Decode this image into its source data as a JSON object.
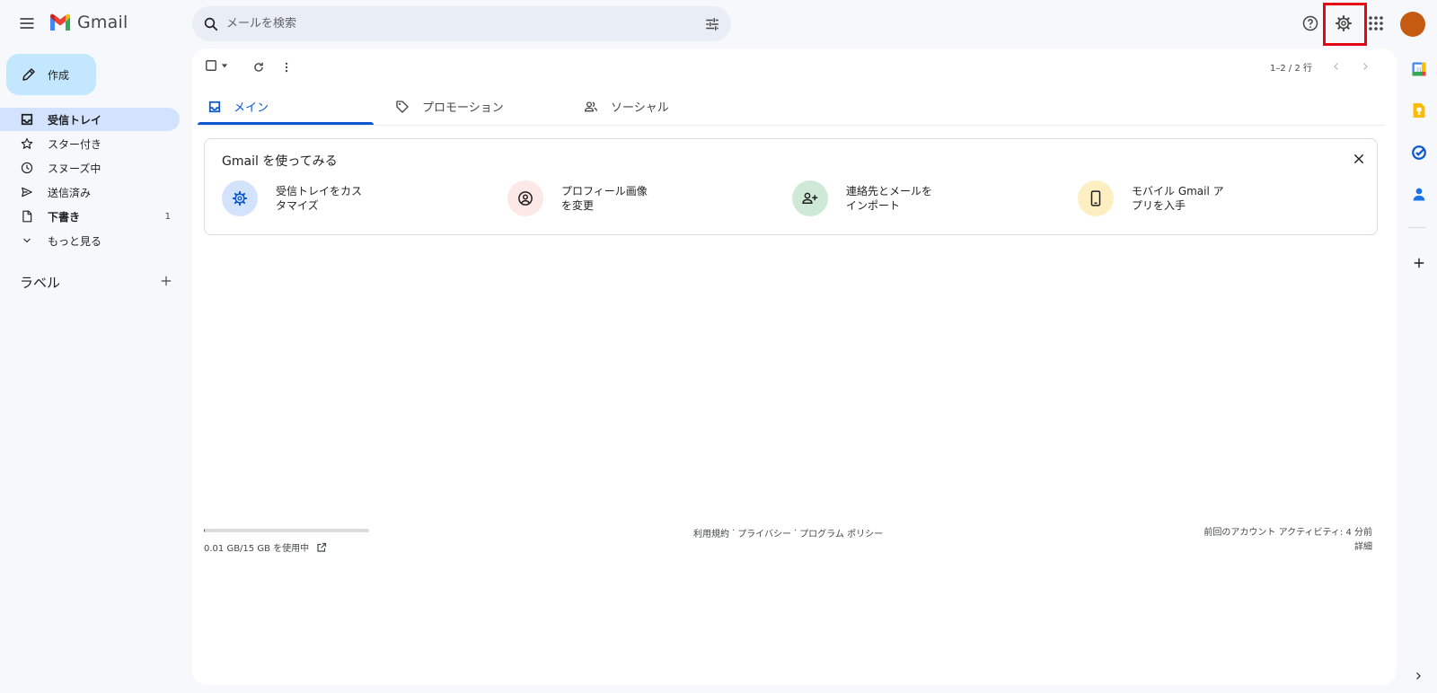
{
  "header": {
    "logo_text": "Gmail",
    "search_placeholder": "メールを検索"
  },
  "compose": {
    "label": "作成"
  },
  "sidebar": {
    "items": [
      {
        "label": "受信トレイ",
        "icon": "inbox-icon",
        "active": true
      },
      {
        "label": "スター付き",
        "icon": "star-icon"
      },
      {
        "label": "スヌーズ中",
        "icon": "clock-icon"
      },
      {
        "label": "送信済み",
        "icon": "send-icon"
      },
      {
        "label": "下書き",
        "icon": "draft-icon",
        "count": "1"
      },
      {
        "label": "もっと見る",
        "icon": "chevron-down-icon"
      }
    ],
    "labels_title": "ラベル"
  },
  "toolbar": {
    "page_range": "1–2 / 2 行"
  },
  "tabs": [
    {
      "label": "メイン",
      "icon": "inbox-icon",
      "active": true
    },
    {
      "label": "プロモーション",
      "icon": "tag-icon"
    },
    {
      "label": "ソーシャル",
      "icon": "people-icon"
    }
  ],
  "getting_started": {
    "title": "Gmail を使ってみる",
    "items": [
      {
        "line1": "受信トレイをカス",
        "line2": "タマイズ",
        "icon": "gear-icon",
        "bg": "#d3e3fd",
        "fg": "#0b57d0"
      },
      {
        "line1": "プロフィール画像",
        "line2": "を変更",
        "icon": "account-circle-icon",
        "bg": "#fce8e6",
        "fg": "#1f1f1f"
      },
      {
        "line1": "連絡先とメールを",
        "line2": "インポート",
        "icon": "person-add-icon",
        "bg": "#ceead6",
        "fg": "#1f1f1f"
      },
      {
        "line1": "モバイル Gmail ア",
        "line2": "プリを入手",
        "icon": "phone-icon",
        "bg": "#feefc3",
        "fg": "#1f1f1f"
      }
    ]
  },
  "footer": {
    "storage_text": "0.01 GB/15 GB を使用中",
    "storage_fraction": 0.0007,
    "links": [
      "利用規約",
      "·",
      "プライバシー",
      "·",
      "プログラム ポリシー"
    ],
    "activity": "前回のアカウント アクティビティ: 4 分前",
    "details": "詳細"
  },
  "side_apps": [
    "calendar-icon",
    "keep-icon",
    "tasks-icon",
    "contacts-icon"
  ],
  "colors": {
    "accent": "#0b57d0",
    "compose_bg": "#c2e7ff",
    "active_nav": "#d3e3fd",
    "highlight": "#e30613",
    "avatar": "#c55a11"
  }
}
